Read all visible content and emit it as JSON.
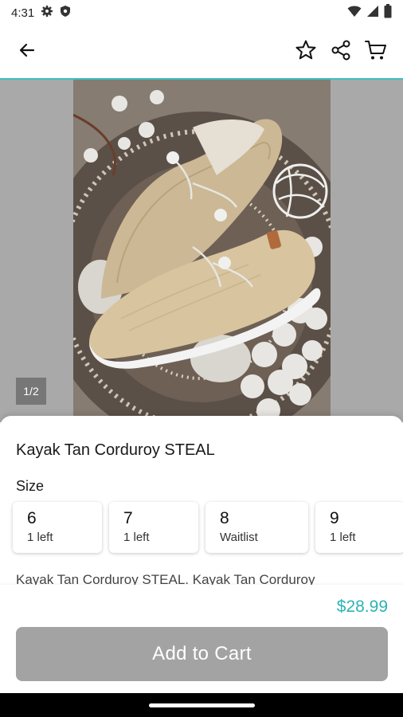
{
  "status_bar": {
    "time": "4:31"
  },
  "gallery": {
    "page_indicator": "1/2"
  },
  "product": {
    "title": "Kayak Tan Corduroy STEAL",
    "size_label": "Size",
    "sizes": [
      {
        "size": "6",
        "stock": "1 left"
      },
      {
        "size": "7",
        "stock": "1 left"
      },
      {
        "size": "8",
        "stock": "Waitlist"
      },
      {
        "size": "9",
        "stock": "1 left"
      }
    ],
    "description": "Kayak Tan Corduroy STEAL. Kayak Tan Corduroy",
    "price": "$28.99"
  },
  "actions": {
    "add_to_cart": "Add to Cart"
  },
  "colors": {
    "accent": "#3fbfc1",
    "price": "#2db3b5",
    "button_disabled": "#a3a3a3"
  },
  "icons": [
    "settings-icon",
    "shield-icon",
    "wifi-icon",
    "signal-icon",
    "battery-icon",
    "back-arrow-icon",
    "star-icon",
    "share-icon",
    "cart-icon"
  ]
}
